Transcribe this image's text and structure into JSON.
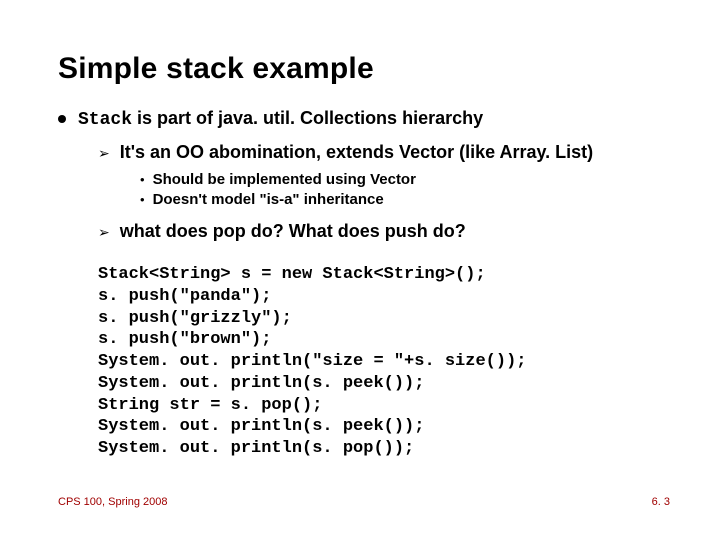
{
  "title": "Simple stack example",
  "l1": {
    "prefix_mono": "Stack",
    "rest": " is part of java. util. Collections hierarchy"
  },
  "l2a": "It's an OO abomination, extends Vector (like Array. List)",
  "l3a": "Should be implemented using Vector",
  "l3b": "Doesn't model \"is-a\" inheritance",
  "l2b": "what does pop do? What does push do?",
  "code": "Stack<String> s = new Stack<String>();\ns. push(\"panda\");\ns. push(\"grizzly\");\ns. push(\"brown\");\nSystem. out. println(\"size = \"+s. size());\nSystem. out. println(s. peek());\nString str = s. pop();\nSystem. out. println(s. peek());\nSystem. out. println(s. pop());",
  "footer_left": "CPS 100, Spring 2008",
  "footer_right": "6. 3"
}
